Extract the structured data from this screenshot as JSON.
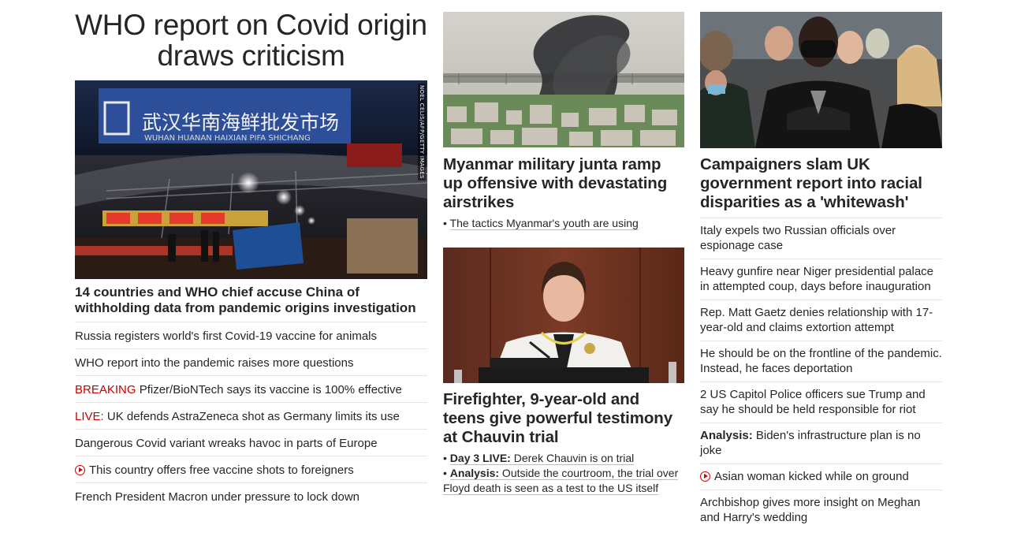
{
  "left": {
    "section_title": "WHO report on Covid origin draws criticism",
    "image_credit": "NOEL CELIS/AFP/GETTY IMAGES",
    "image_sign_cn": "武汉华南海鲜批发市场",
    "image_sign_en": "WUHAN HUANAN HAIXIAN PIFA SHICHANG",
    "lead_headline": "14 countries and WHO chief accuse China of withholding data from pandemic origins investigation",
    "items": [
      {
        "tag": "",
        "text": "Russia registers world's first Covid-19 vaccine for animals"
      },
      {
        "tag": "",
        "text": "WHO report into the pandemic raises more questions"
      },
      {
        "tag": "BREAKING",
        "text": " Pfizer/BioNTech says its vaccine is 100% effective"
      },
      {
        "tag": "LIVE:",
        "text": " UK defends AstraZeneca shot as Germany limits its use"
      },
      {
        "tag": "",
        "text": "Dangerous Covid variant wreaks havoc in parts of Europe"
      },
      {
        "tag": "",
        "text": "This country offers free vaccine shots to foreigners",
        "icon": "play-icon"
      },
      {
        "tag": "",
        "text": "French President Macron under pressure to lock down"
      }
    ]
  },
  "middle": {
    "story1": {
      "headline": "Myanmar military junta ramp up offensive with devastating airstrikes",
      "sub": "The tactics Myanmar's youth are using"
    },
    "story2": {
      "headline": "Firefighter, 9-year-old and teens give powerful testimony at Chauvin trial",
      "subs": [
        {
          "label": "Day 3 LIVE:",
          "text": " Derek Chauvin is on trial"
        },
        {
          "label": "Analysis:",
          "text": " Outside the courtroom, the trial over Floyd death is seen as a test to the US itself"
        }
      ]
    }
  },
  "right": {
    "headline": "Campaigners slam UK government report into racial disparities as a 'whitewash'",
    "items": [
      {
        "label": "",
        "text": "Italy expels two Russian officials over espionage case"
      },
      {
        "label": "",
        "text": "Heavy gunfire near Niger presidential palace in attempted coup, days before inauguration"
      },
      {
        "label": "",
        "text": "Rep. Matt Gaetz denies relationship with 17-year-old and claims extortion attempt"
      },
      {
        "label": "",
        "text": "He should be on the frontline of the pandemic. Instead, he faces deportation"
      },
      {
        "label": "",
        "text": "2 US Capitol Police officers sue Trump and say he should be held responsible for riot"
      },
      {
        "label": "Analysis:",
        "text": " Biden's infrastructure plan is no joke"
      },
      {
        "label": "",
        "text": "Asian woman kicked while on ground",
        "icon": "play-icon"
      },
      {
        "label": "",
        "text": "Archbishop gives more insight on Meghan and Harry's wedding"
      }
    ]
  },
  "colors": {
    "accent_red": "#cc0000",
    "text": "#262626",
    "divider": "#e6e6e6"
  }
}
